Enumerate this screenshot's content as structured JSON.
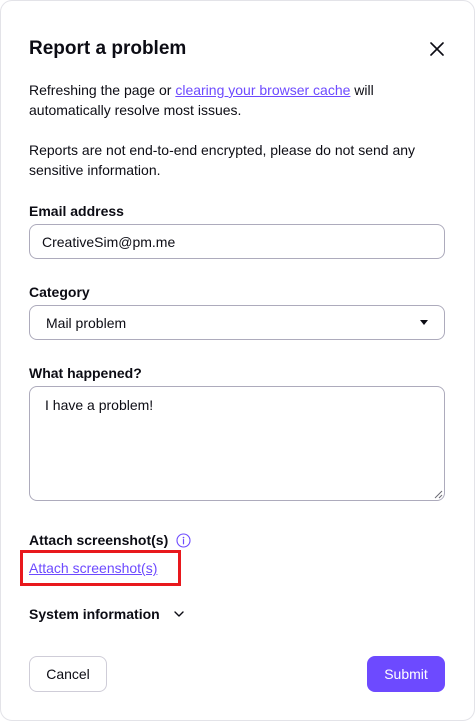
{
  "dialog": {
    "title": "Report a problem",
    "close_icon": "close-icon"
  },
  "intro": {
    "text_before": "Refreshing the page or ",
    "link_text": "clearing your browser cache",
    "text_after": " will automatically resolve most issues."
  },
  "warning": {
    "text": "Reports are not end-to-end encrypted, please do not send any sensitive information."
  },
  "email": {
    "label": "Email address",
    "value": "CreativeSim@pm.me"
  },
  "category": {
    "label": "Category",
    "selected": "Mail problem",
    "icon": "caret-down-icon"
  },
  "description": {
    "label": "What happened?",
    "value": "I have a problem!"
  },
  "attachments": {
    "label": "Attach screenshot(s)",
    "info_icon": "info-icon",
    "link_text": "Attach screenshot(s)"
  },
  "system_info": {
    "label": "System information",
    "icon": "chevron-down-icon"
  },
  "actions": {
    "cancel_label": "Cancel",
    "submit_label": "Submit"
  },
  "colors": {
    "accent": "#6d4aff",
    "highlight": "#e8181d",
    "border": "#adabbc",
    "text": "#0c0c14"
  }
}
